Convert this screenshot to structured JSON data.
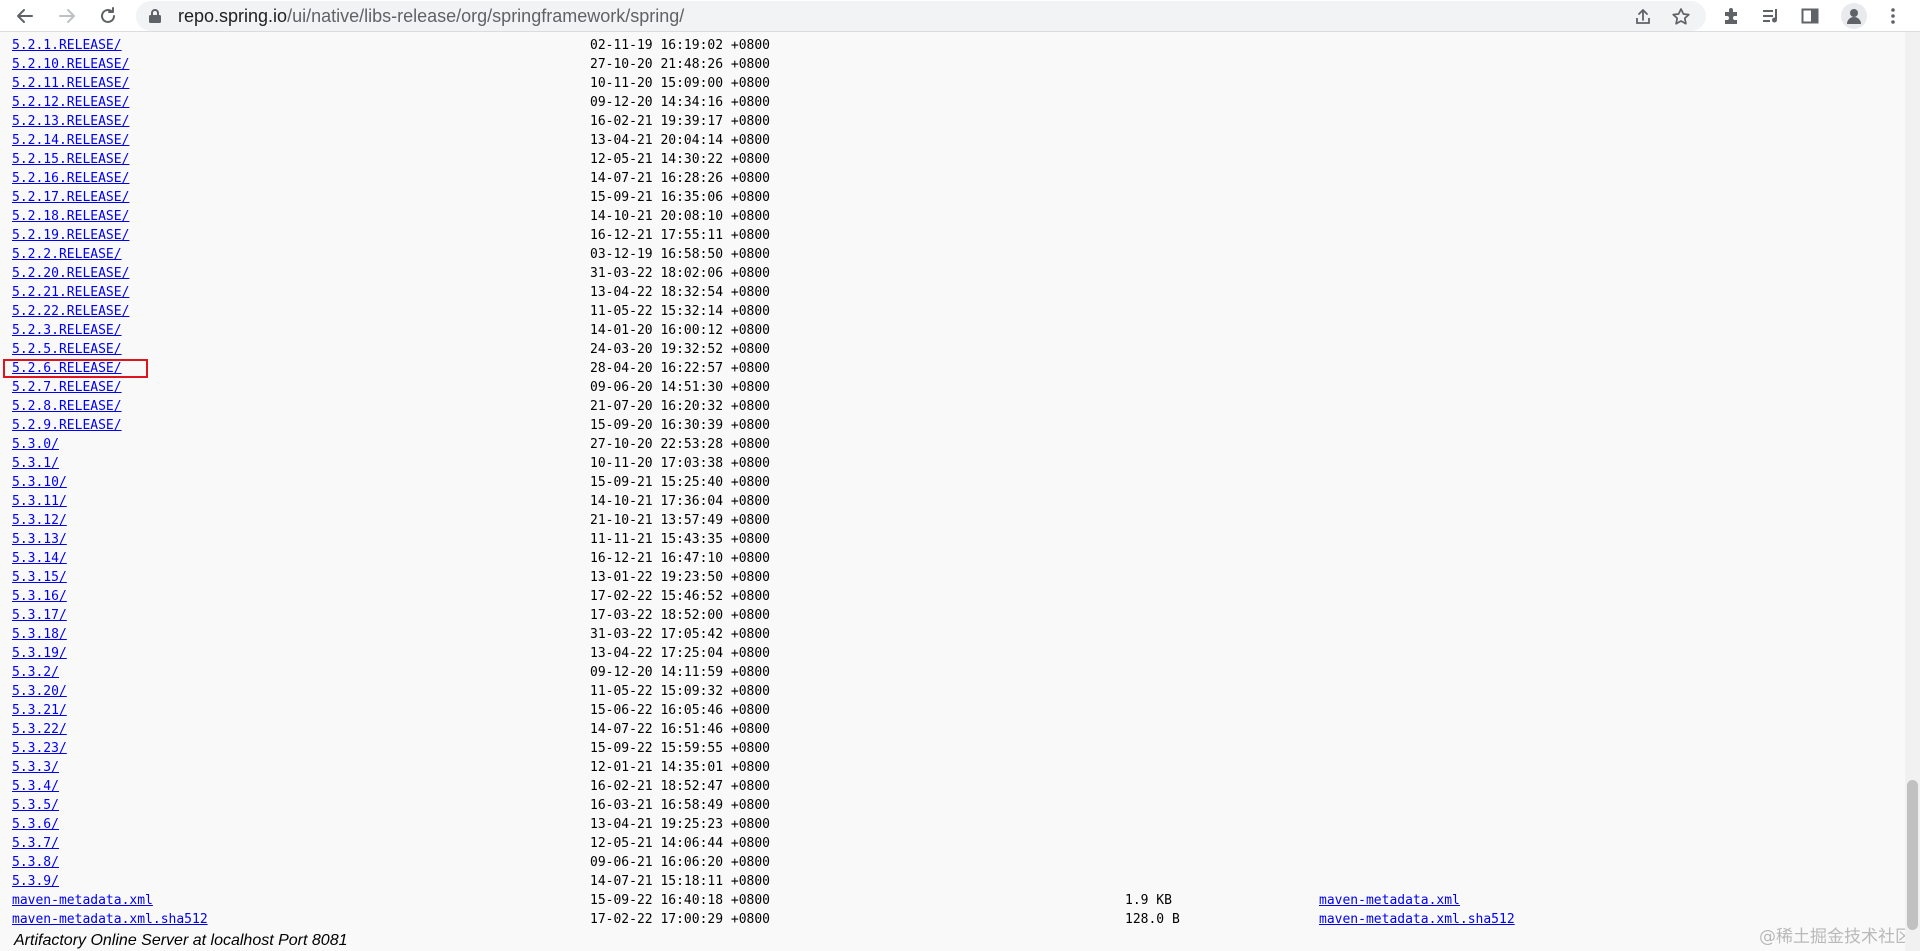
{
  "browser": {
    "url_host": "repo.spring.io",
    "url_path": "/ui/native/libs-release/org/springframework/spring/"
  },
  "listing": [
    {
      "name": "5.2.1.RELEASE/",
      "date": "02-11-19 16:19:02 +0800",
      "size": "",
      "link": ""
    },
    {
      "name": "5.2.10.RELEASE/",
      "date": "27-10-20 21:48:26 +0800",
      "size": "",
      "link": ""
    },
    {
      "name": "5.2.11.RELEASE/",
      "date": "10-11-20 15:09:00 +0800",
      "size": "",
      "link": ""
    },
    {
      "name": "5.2.12.RELEASE/",
      "date": "09-12-20 14:34:16 +0800",
      "size": "",
      "link": ""
    },
    {
      "name": "5.2.13.RELEASE/",
      "date": "16-02-21 19:39:17 +0800",
      "size": "",
      "link": ""
    },
    {
      "name": "5.2.14.RELEASE/",
      "date": "13-04-21 20:04:14 +0800",
      "size": "",
      "link": ""
    },
    {
      "name": "5.2.15.RELEASE/",
      "date": "12-05-21 14:30:22 +0800",
      "size": "",
      "link": ""
    },
    {
      "name": "5.2.16.RELEASE/",
      "date": "14-07-21 16:28:26 +0800",
      "size": "",
      "link": ""
    },
    {
      "name": "5.2.17.RELEASE/",
      "date": "15-09-21 16:35:06 +0800",
      "size": "",
      "link": ""
    },
    {
      "name": "5.2.18.RELEASE/",
      "date": "14-10-21 20:08:10 +0800",
      "size": "",
      "link": ""
    },
    {
      "name": "5.2.19.RELEASE/",
      "date": "16-12-21 17:55:11 +0800",
      "size": "",
      "link": ""
    },
    {
      "name": "5.2.2.RELEASE/",
      "date": "03-12-19 16:58:50 +0800",
      "size": "",
      "link": ""
    },
    {
      "name": "5.2.20.RELEASE/",
      "date": "31-03-22 18:02:06 +0800",
      "size": "",
      "link": ""
    },
    {
      "name": "5.2.21.RELEASE/",
      "date": "13-04-22 18:32:54 +0800",
      "size": "",
      "link": ""
    },
    {
      "name": "5.2.22.RELEASE/",
      "date": "11-05-22 15:32:14 +0800",
      "size": "",
      "link": ""
    },
    {
      "name": "5.2.3.RELEASE/",
      "date": "14-01-20 16:00:12 +0800",
      "size": "",
      "link": ""
    },
    {
      "name": "5.2.5.RELEASE/",
      "date": "24-03-20 19:32:52 +0800",
      "size": "",
      "link": ""
    },
    {
      "name": "5.2.6.RELEASE/",
      "date": "28-04-20 16:22:57 +0800",
      "size": "",
      "link": ""
    },
    {
      "name": "5.2.7.RELEASE/",
      "date": "09-06-20 14:51:30 +0800",
      "size": "",
      "link": ""
    },
    {
      "name": "5.2.8.RELEASE/",
      "date": "21-07-20 16:20:32 +0800",
      "size": "",
      "link": ""
    },
    {
      "name": "5.2.9.RELEASE/",
      "date": "15-09-20 16:30:39 +0800",
      "size": "",
      "link": ""
    },
    {
      "name": "5.3.0/",
      "date": "27-10-20 22:53:28 +0800",
      "size": "",
      "link": ""
    },
    {
      "name": "5.3.1/",
      "date": "10-11-20 17:03:38 +0800",
      "size": "",
      "link": ""
    },
    {
      "name": "5.3.10/",
      "date": "15-09-21 15:25:40 +0800",
      "size": "",
      "link": ""
    },
    {
      "name": "5.3.11/",
      "date": "14-10-21 17:36:04 +0800",
      "size": "",
      "link": ""
    },
    {
      "name": "5.3.12/",
      "date": "21-10-21 13:57:49 +0800",
      "size": "",
      "link": ""
    },
    {
      "name": "5.3.13/",
      "date": "11-11-21 15:43:35 +0800",
      "size": "",
      "link": ""
    },
    {
      "name": "5.3.14/",
      "date": "16-12-21 16:47:10 +0800",
      "size": "",
      "link": ""
    },
    {
      "name": "5.3.15/",
      "date": "13-01-22 19:23:50 +0800",
      "size": "",
      "link": ""
    },
    {
      "name": "5.3.16/",
      "date": "17-02-22 15:46:52 +0800",
      "size": "",
      "link": ""
    },
    {
      "name": "5.3.17/",
      "date": "17-03-22 18:52:00 +0800",
      "size": "",
      "link": ""
    },
    {
      "name": "5.3.18/",
      "date": "31-03-22 17:05:42 +0800",
      "size": "",
      "link": ""
    },
    {
      "name": "5.3.19/",
      "date": "13-04-22 17:25:04 +0800",
      "size": "",
      "link": ""
    },
    {
      "name": "5.3.2/",
      "date": "09-12-20 14:11:59 +0800",
      "size": "",
      "link": ""
    },
    {
      "name": "5.3.20/",
      "date": "11-05-22 15:09:32 +0800",
      "size": "",
      "link": ""
    },
    {
      "name": "5.3.21/",
      "date": "15-06-22 16:05:46 +0800",
      "size": "",
      "link": ""
    },
    {
      "name": "5.3.22/",
      "date": "14-07-22 16:51:46 +0800",
      "size": "",
      "link": ""
    },
    {
      "name": "5.3.23/",
      "date": "15-09-22 15:59:55 +0800",
      "size": "",
      "link": ""
    },
    {
      "name": "5.3.3/",
      "date": "12-01-21 14:35:01 +0800",
      "size": "",
      "link": ""
    },
    {
      "name": "5.3.4/",
      "date": "16-02-21 18:52:47 +0800",
      "size": "",
      "link": ""
    },
    {
      "name": "5.3.5/",
      "date": "16-03-21 16:58:49 +0800",
      "size": "",
      "link": ""
    },
    {
      "name": "5.3.6/",
      "date": "13-04-21 19:25:23 +0800",
      "size": "",
      "link": ""
    },
    {
      "name": "5.3.7/",
      "date": "12-05-21 14:06:44 +0800",
      "size": "",
      "link": ""
    },
    {
      "name": "5.3.8/",
      "date": "09-06-21 16:06:20 +0800",
      "size": "",
      "link": ""
    },
    {
      "name": "5.3.9/",
      "date": "14-07-21 15:18:11 +0800",
      "size": "",
      "link": ""
    },
    {
      "name": "maven-metadata.xml",
      "date": "15-09-22 16:40:18 +0800",
      "size": "1.9 KB",
      "link": "maven-metadata.xml"
    },
    {
      "name": "maven-metadata.xml.sha512",
      "date": "17-02-22 17:00:29 +0800",
      "size": "128.0 B",
      "link": "maven-metadata.xml.sha512"
    }
  ],
  "highlighted_item": "5.2.6.RELEASE/",
  "footer": {
    "text": "Artifactory Online Server at localhost Port 8081"
  },
  "watermark": "@稀土掘金技术社区",
  "icons": {
    "back": "back-arrow-icon",
    "forward": "forward-arrow-icon",
    "reload": "reload-icon",
    "lock": "lock-icon",
    "share": "share-icon",
    "bookmark": "star-icon",
    "extensions": "puzzle-icon",
    "media": "media-queue-icon",
    "sidepanel": "side-panel-icon",
    "profile": "profile-icon",
    "menu": "kebab-menu-icon"
  },
  "colors": {
    "link": "#0000ee",
    "highlight": "#e0141e",
    "page_bg": "#f9f9f9"
  }
}
